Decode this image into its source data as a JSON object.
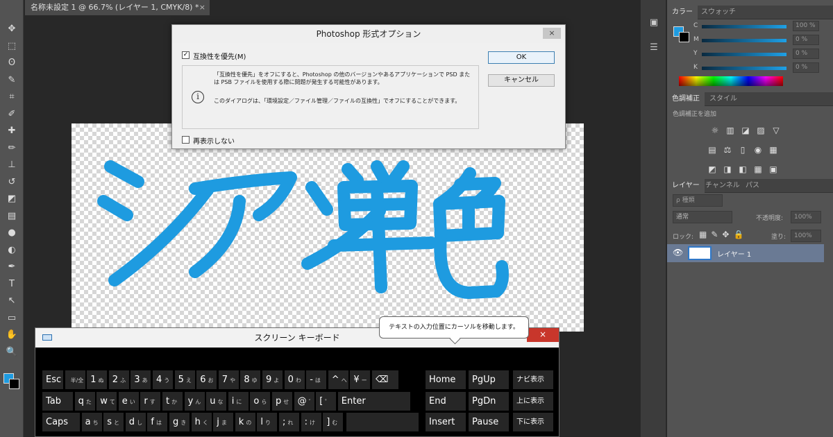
{
  "document": {
    "tab_title": "名称未設定 1 @ 66.7% (レイヤー 1, CMYK/8) *",
    "tab_close": "×"
  },
  "canvas": {
    "artwork_text": "シアン単色",
    "ink_color": "#1e9be0"
  },
  "tools": [
    "move-tool",
    "marquee-tool",
    "lasso-tool",
    "quick-select-tool",
    "crop-tool",
    "eyedropper-tool",
    "healing-tool",
    "brush-tool",
    "stamp-tool",
    "history-brush-tool",
    "eraser-tool",
    "gradient-tool",
    "blur-tool",
    "dodge-tool",
    "pen-tool",
    "type-tool",
    "path-select-tool",
    "shape-tool",
    "hand-tool",
    "zoom-tool"
  ],
  "tool_glyphs": [
    "✥",
    "⬚",
    "ʘ",
    "✎",
    "⌗",
    "✐",
    "✚",
    "✏",
    "⊥",
    "↺",
    "◩",
    "▤",
    "●",
    "◐",
    "✒",
    "T",
    "↖",
    "▭",
    "✋",
    "🔍"
  ],
  "color_panel": {
    "tabs": [
      "カラー",
      "スウォッチ"
    ],
    "channels": [
      {
        "label": "C",
        "value": "100",
        "unit": "%",
        "color": "#1ea0e6"
      },
      {
        "label": "M",
        "value": "0",
        "unit": "%",
        "color": "#1ea0e6"
      },
      {
        "label": "Y",
        "value": "0",
        "unit": "%",
        "color": "#1ea0e6"
      },
      {
        "label": "K",
        "value": "0",
        "unit": "%",
        "color": "#1ea0e6"
      }
    ]
  },
  "adjustments_panel": {
    "tabs": [
      "色調補正",
      "スタイル"
    ],
    "subtitle": "色調補正を追加"
  },
  "layers_panel": {
    "tabs": [
      "レイヤー",
      "チャンネル",
      "パス"
    ],
    "filter_label": "ρ 種類",
    "blend_mode": "通常",
    "opacity_label": "不透明度:",
    "opacity_value": "100%",
    "lock_label": "ロック:",
    "fill_label": "塗り:",
    "fill_value": "100%",
    "layer_name": "レイヤー 1"
  },
  "dialog": {
    "title": "Photoshop 形式オプション",
    "close": "×",
    "checkbox_label": "互換性を優先(M)",
    "checkbox_mark": "✓",
    "message_1": "「互換性を優先」をオフにすると、Photoshop の他のバージョンやあるアプリケーションで PSD または PSB ファイルを使用する際に問題が発生する可能性があります。",
    "message_2": "このダイアログは、「環境設定／ファイル管理／ファイルの互換性」でオフにすることができます。",
    "info_glyph": "i",
    "ok_label": "OK",
    "cancel_label": "キャンセル",
    "dont_show_label": "再表示しない"
  },
  "keyboard": {
    "title": "スクリーン キーボード",
    "close": "×",
    "tooltip": "テキストの入力位置にカーソルを移動します。",
    "row1": [
      {
        "k": "Esc",
        "s": ""
      },
      {
        "k": "",
        "s": "半/全"
      },
      {
        "k": "1",
        "s": "ぬ"
      },
      {
        "k": "2",
        "s": "ふ"
      },
      {
        "k": "3",
        "s": "あ"
      },
      {
        "k": "4",
        "s": "う"
      },
      {
        "k": "5",
        "s": "え"
      },
      {
        "k": "6",
        "s": "お"
      },
      {
        "k": "7",
        "s": "や"
      },
      {
        "k": "8",
        "s": "ゆ"
      },
      {
        "k": "9",
        "s": "よ"
      },
      {
        "k": "0",
        "s": "わ"
      },
      {
        "k": "-",
        "s": "ほ"
      },
      {
        "k": "^",
        "s": "へ"
      },
      {
        "k": "¥",
        "s": "ー"
      },
      {
        "k": "⌫",
        "s": ""
      }
    ],
    "row2": [
      {
        "k": "Tab",
        "s": ""
      },
      {
        "k": "q",
        "s": "た"
      },
      {
        "k": "w",
        "s": "て"
      },
      {
        "k": "e",
        "s": "い"
      },
      {
        "k": "r",
        "s": "す"
      },
      {
        "k": "t",
        "s": "か"
      },
      {
        "k": "y",
        "s": "ん"
      },
      {
        "k": "u",
        "s": "な"
      },
      {
        "k": "i",
        "s": "に"
      },
      {
        "k": "o",
        "s": "ら"
      },
      {
        "k": "p",
        "s": "せ"
      },
      {
        "k": "@",
        "s": "゛"
      },
      {
        "k": "[",
        "s": "゜"
      },
      {
        "k": "Enter",
        "s": ""
      }
    ],
    "row3": [
      {
        "k": "Caps",
        "s": ""
      },
      {
        "k": "a",
        "s": "ち"
      },
      {
        "k": "s",
        "s": "と"
      },
      {
        "k": "d",
        "s": "し"
      },
      {
        "k": "f",
        "s": "は"
      },
      {
        "k": "g",
        "s": "き"
      },
      {
        "k": "h",
        "s": "く"
      },
      {
        "k": "j",
        "s": "ま"
      },
      {
        "k": "k",
        "s": "の"
      },
      {
        "k": "l",
        "s": "り"
      },
      {
        "k": ";",
        "s": "れ"
      },
      {
        "k": ":",
        "s": "け"
      },
      {
        "k": "]",
        "s": "む"
      }
    ],
    "nav": {
      "home": "Home",
      "pgup": "PgUp",
      "nav": "ナビ表示",
      "end": "End",
      "pgdn": "PgDn",
      "up": "上に表示",
      "insert": "Insert",
      "pause": "Pause",
      "down": "下に表示"
    }
  }
}
